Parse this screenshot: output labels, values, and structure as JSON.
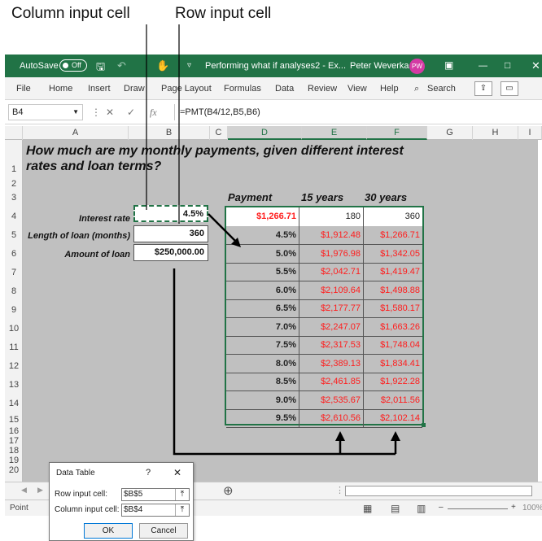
{
  "callouts": {
    "column_input": "Column input cell",
    "row_input": "Row input cell"
  },
  "titlebar": {
    "autosave": "AutoSave",
    "autosave_state": "Off",
    "doc_title": "Performing what if analyses2 - Ex...",
    "user": "Peter Weverka",
    "user_initials": "PW",
    "color": "#217346"
  },
  "ribbon": {
    "tabs": [
      "File",
      "Home",
      "Insert",
      "Draw",
      "Page Layout",
      "Formulas",
      "Data",
      "Review",
      "View",
      "Help"
    ],
    "search": "Search"
  },
  "formula_bar": {
    "name_box": "B4",
    "fx": "fx",
    "formula": "=PMT(B4/12,B5,B6)"
  },
  "columns": [
    "A",
    "B",
    "C",
    "D",
    "E",
    "F",
    "G",
    "H",
    "I"
  ],
  "rows": [
    "1",
    "2",
    "3",
    "4",
    "5",
    "6",
    "7",
    "8",
    "9",
    "10",
    "11",
    "12",
    "13",
    "14",
    "15",
    "16",
    "17",
    "18",
    "19",
    "20"
  ],
  "sheet": {
    "title": "How much are my monthly payments, given different interest rates and loan terms?",
    "labels": {
      "interest_rate": "Interest rate",
      "loan_length": "Length of loan (months)",
      "loan_amount": "Amount of loan"
    },
    "values": {
      "interest_rate": "4.5%",
      "loan_length": "360",
      "loan_amount": "$250,000.00"
    },
    "table_headers": {
      "payment": "Payment",
      "fifteen": "15 years",
      "thirty": "30 years"
    },
    "table_top": {
      "payment": "$1,266.71",
      "months_15": "180",
      "months_30": "360"
    },
    "table_rows": [
      {
        "rate": "4.5%",
        "y15": "$1,912.48",
        "y30": "$1,266.71"
      },
      {
        "rate": "5.0%",
        "y15": "$1,976.98",
        "y30": "$1,342.05"
      },
      {
        "rate": "5.5%",
        "y15": "$2,042.71",
        "y30": "$1,419.47"
      },
      {
        "rate": "6.0%",
        "y15": "$2,109.64",
        "y30": "$1,498.88"
      },
      {
        "rate": "6.5%",
        "y15": "$2,177.77",
        "y30": "$1,580.17"
      },
      {
        "rate": "7.0%",
        "y15": "$2,247.07",
        "y30": "$1,663.26"
      },
      {
        "rate": "7.5%",
        "y15": "$2,317.53",
        "y30": "$1,748.04"
      },
      {
        "rate": "8.0%",
        "y15": "$2,389.13",
        "y30": "$1,834.41"
      },
      {
        "rate": "8.5%",
        "y15": "$2,461.85",
        "y30": "$1,922.28"
      },
      {
        "rate": "9.0%",
        "y15": "$2,535.67",
        "y30": "$2,011.56"
      },
      {
        "rate": "9.5%",
        "y15": "$2,610.56",
        "y30": "$2,102.14"
      }
    ]
  },
  "status": {
    "mode": "Point",
    "zoom": "100%"
  },
  "dialog": {
    "title": "Data Table",
    "help": "?",
    "close": "✕",
    "row_label": "Row input cell:",
    "row_value": "$B$5",
    "col_label": "Column input cell:",
    "col_value": "$B$4",
    "ok": "OK",
    "cancel": "Cancel"
  }
}
